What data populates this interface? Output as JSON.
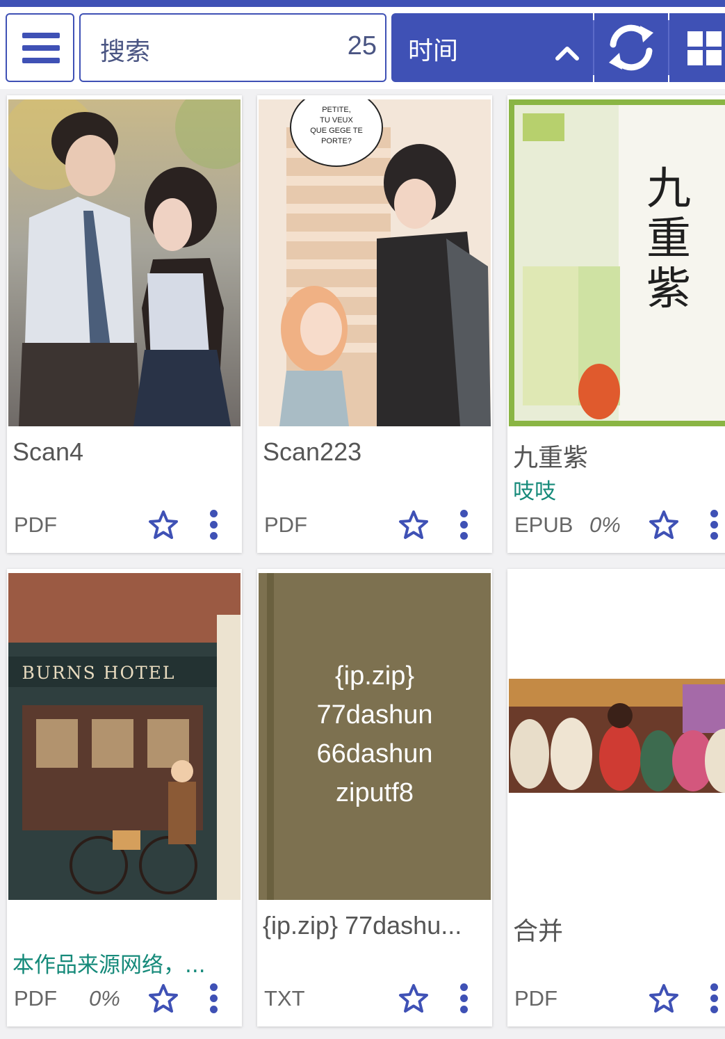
{
  "toolbar": {
    "menu_icon": "hamburger-menu-icon",
    "search_placeholder": "搜索",
    "book_count": "25",
    "sort_label": "时间",
    "sort_direction_icon": "chevron-up-icon",
    "refresh_icon": "refresh-icon",
    "view_mode_icon": "grid-view-icon"
  },
  "colors": {
    "primary": "#3f51b5",
    "author_text": "#168a7a",
    "cover_olive": "#7d7150"
  },
  "books": [
    {
      "title": "Scan4",
      "author": "",
      "type": "PDF",
      "progress": "",
      "cover": "illustrated-couple-cover"
    },
    {
      "title": "Scan223",
      "author": "",
      "type": "PDF",
      "progress": "",
      "cover": "manga-staircase-cover",
      "cover_text": "PETITE, TU VEUX QUE GEGE TE PORTE?"
    },
    {
      "title": "九重紫",
      "author": "吱吱",
      "type": "EPUB",
      "progress": "0%",
      "cover": "chinese-novel-cover",
      "cover_text": "九重紫"
    },
    {
      "title": "",
      "author": "本作品来源网络，...",
      "type": "PDF",
      "progress": "0%",
      "cover": "burns-hotel-cover",
      "cover_text": "BURNS HOTEL"
    },
    {
      "title": "{ip.zip} 77dashu...",
      "author": "",
      "type": "TXT",
      "progress": "",
      "cover": "generated-text-cover",
      "cover_lines": [
        "{ip.zip}",
        "77dashun",
        "66dashun",
        "ziputf8"
      ]
    },
    {
      "title": "合并",
      "author": "",
      "type": "PDF",
      "progress": "",
      "cover": "anime-scene-cover"
    }
  ]
}
